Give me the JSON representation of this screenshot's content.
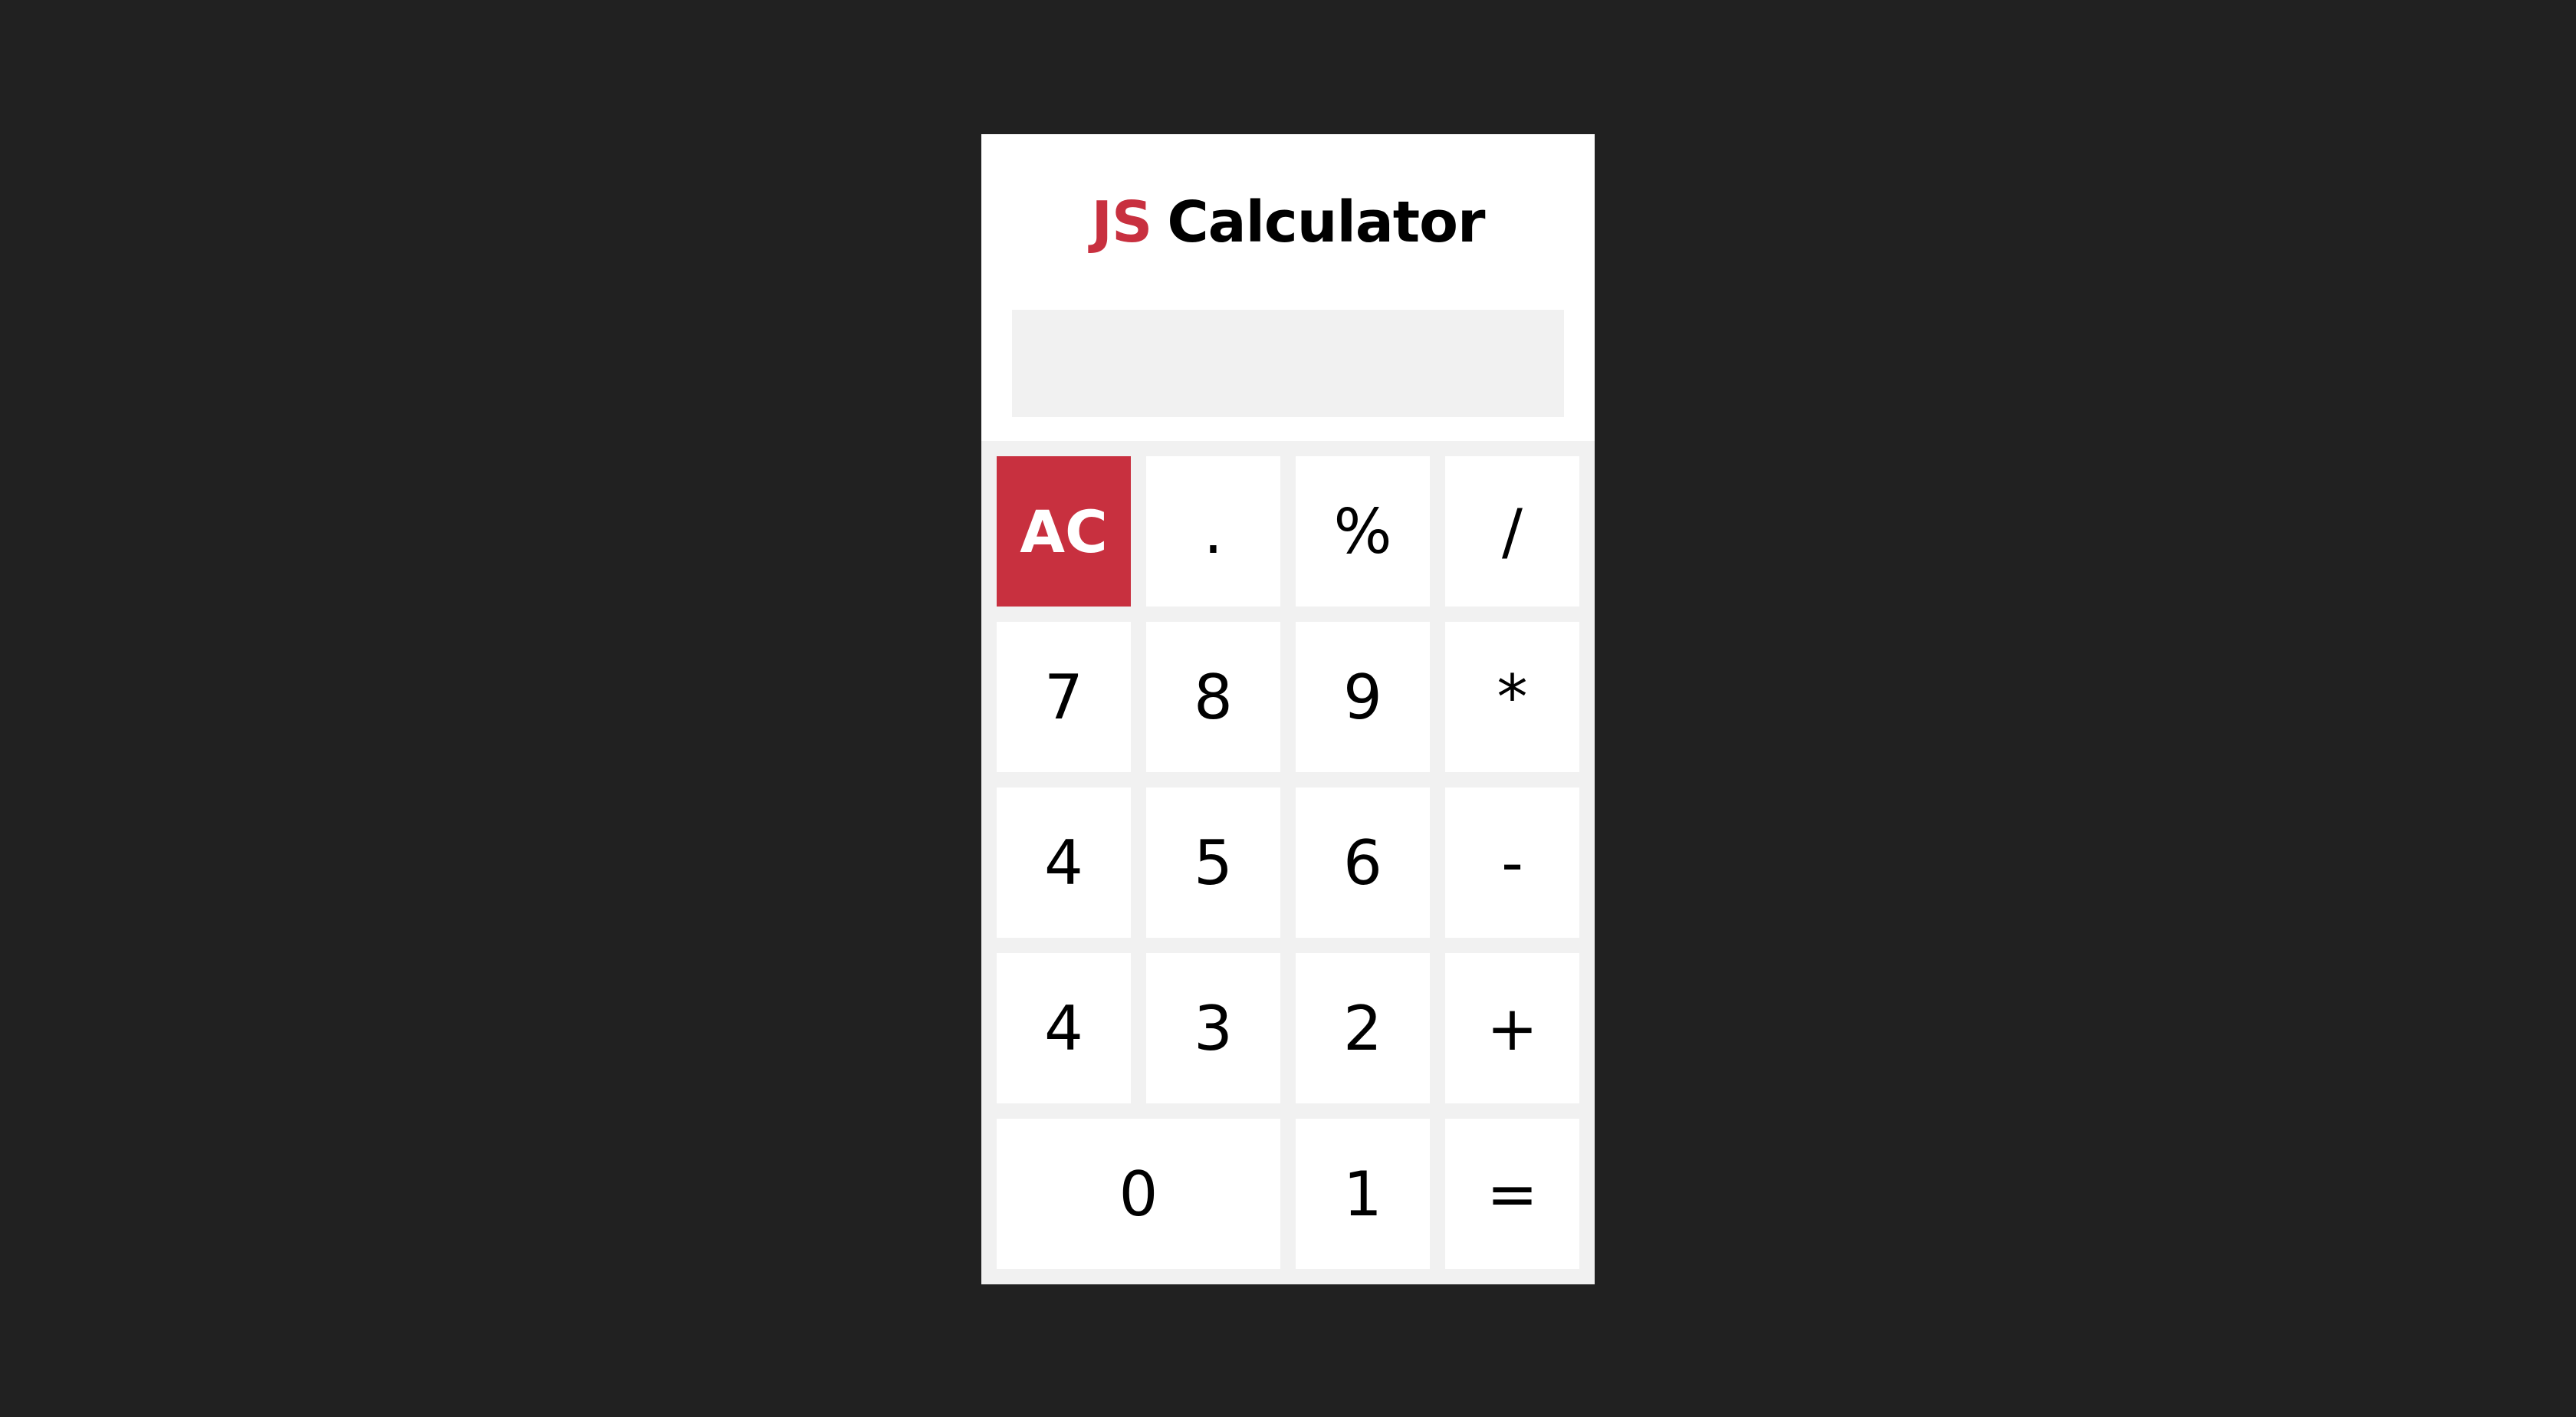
{
  "title": {
    "accent": "JS",
    "main": "Calculator"
  },
  "display": {
    "value": ""
  },
  "keys": {
    "clear": "AC",
    "decimal": ".",
    "percent": "%",
    "divide": "/",
    "seven": "7",
    "eight": "8",
    "nine": "9",
    "multiply": "*",
    "four_a": "4",
    "five": "5",
    "six": "6",
    "subtract": "-",
    "four_b": "4",
    "three": "3",
    "two": "2",
    "add": "+",
    "zero": "0",
    "one": "1",
    "equals": "="
  },
  "colors": {
    "background": "#212121",
    "accent": "#c8303f",
    "panel": "#ffffff",
    "keypad_bg": "#f1f1f1"
  }
}
